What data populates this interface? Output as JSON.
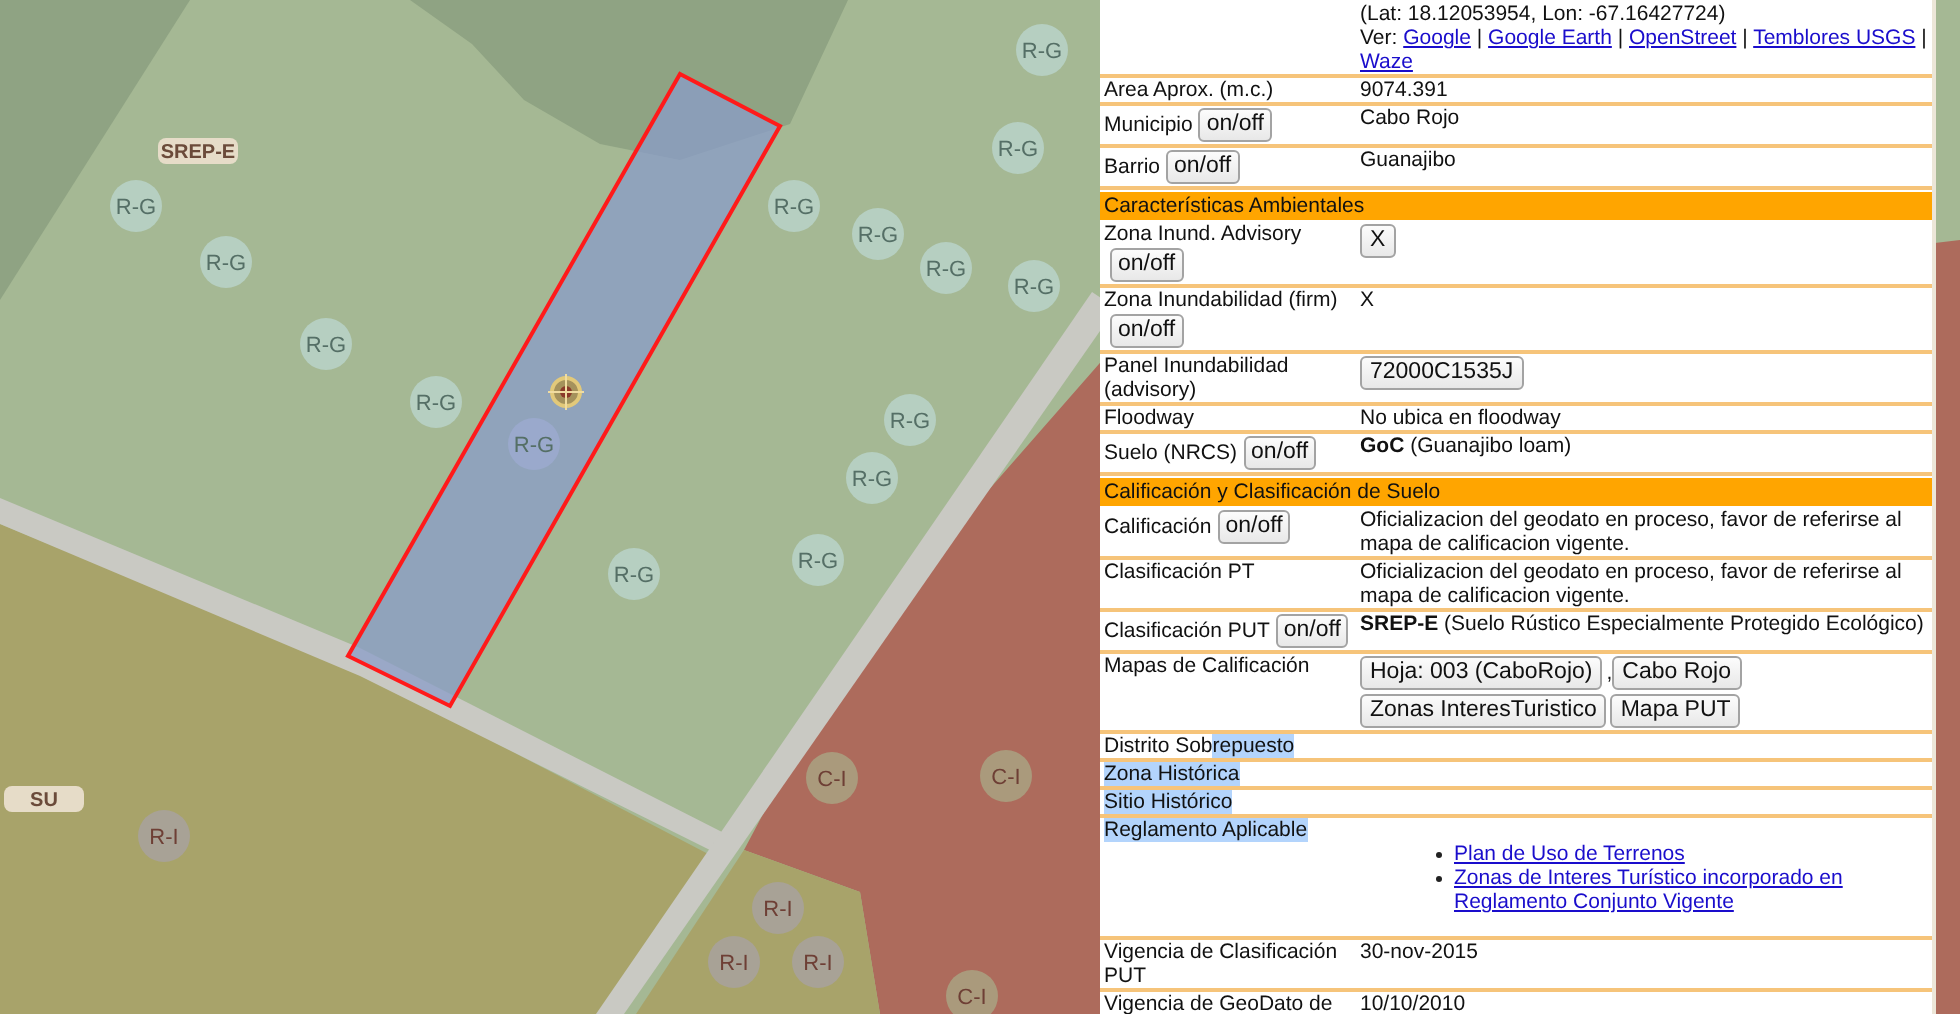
{
  "map": {
    "zone_labels": [
      {
        "text": "SREP-E"
      },
      {
        "text": "SU"
      }
    ],
    "zone_badges": [
      {
        "text": "R-G",
        "color": "#b6cfc1"
      },
      {
        "text": "R-G",
        "color": "#b6cfc1"
      },
      {
        "text": "R-G",
        "color": "#b6cfc1"
      },
      {
        "text": "R-G",
        "color": "#b6cfc1"
      },
      {
        "text": "R-G",
        "color": "#b6cfc1"
      },
      {
        "text": "R-G",
        "color": "#b6cfc1"
      },
      {
        "text": "R-G",
        "color": "#b6cfc1"
      },
      {
        "text": "R-G",
        "color": "#b6cfc1"
      },
      {
        "text": "R-G",
        "color": "#b6cfc1"
      },
      {
        "text": "R-G",
        "color": "#b6cfc1"
      },
      {
        "text": "R-G",
        "color": "#9aa9cc"
      },
      {
        "text": "R-G",
        "color": "#b6cfc1"
      },
      {
        "text": "R-G",
        "color": "#b6cfc1"
      },
      {
        "text": "R-G",
        "color": "#b6cfc1"
      },
      {
        "text": "R-G",
        "color": "#b6cfc1"
      },
      {
        "text": "R-I",
        "color": "#a8a296"
      },
      {
        "text": "R-I",
        "color": "#a8a296"
      },
      {
        "text": "R-I",
        "color": "#a8a296"
      },
      {
        "text": "R-I",
        "color": "#a8a296"
      },
      {
        "text": "C-I",
        "color": "#aa9a7c"
      },
      {
        "text": "C-I",
        "color": "#aa9a7c"
      },
      {
        "text": "C-I",
        "color": "#aa9a7c"
      }
    ]
  },
  "details": {
    "location": {
      "coordinates": "(Lat: 18.12053954, Lon: -67.16427724)",
      "view_label": "Ver:",
      "links": [
        {
          "text": "Google",
          "separator": "|"
        },
        {
          "text": "Google Earth",
          "separator": "|"
        },
        {
          "text": "OpenStreet",
          "separator": "|"
        },
        {
          "text": "Temblores USGS",
          "separator": "|"
        },
        {
          "text": "Waze"
        }
      ]
    },
    "rows": [
      {
        "kind": "field",
        "label": "Area Aprox. (m.c.)",
        "value": "9074.391"
      },
      {
        "kind": "field",
        "label": "Municipio",
        "toggle": "on/off",
        "value": "Cabo Rojo"
      },
      {
        "kind": "field",
        "label": "Barrio",
        "toggle": "on/off",
        "value": "Guanajibo"
      },
      {
        "kind": "section",
        "title": "Características Ambientales"
      },
      {
        "kind": "field",
        "label": "Zona Inund. Advisory",
        "toggle": "on/off",
        "buttons": [
          {
            "label": "X"
          }
        ]
      },
      {
        "kind": "field",
        "label": "Zona Inundabilidad (firm)",
        "toggle": "on/off",
        "value": "X"
      },
      {
        "kind": "field",
        "label": "Panel Inundabilidad (advisory)",
        "buttons": [
          {
            "label": "72000C1535J"
          }
        ]
      },
      {
        "kind": "field",
        "label": "Floodway",
        "value": "No ubica en floodway"
      },
      {
        "kind": "field",
        "label": "Suelo (NRCS)",
        "toggle": "on/off",
        "value": "**GoC** (Guanajibo loam)"
      },
      {
        "kind": "section",
        "title": "Calificación y Clasificación de Suelo"
      },
      {
        "kind": "field",
        "label": "Calificación",
        "toggle": "on/off",
        "value": "Oficializacion del geodato en proceso, favor de referirse al mapa de calificacion vigente."
      },
      {
        "kind": "field",
        "label": "Clasificación PT",
        "value": "Oficializacion del geodato en proceso, favor de referirse al mapa de calificacion vigente."
      },
      {
        "kind": "field",
        "label": "Clasificación PUT",
        "toggle": "on/off",
        "value": "**SREP-E** (Suelo Rústico Especialmente Protegido Ecológico)"
      },
      {
        "kind": "field",
        "label": "Mapas de Calificación",
        "buttons": [
          {
            "label": "Hoja: 003 (CaboRojo)",
            "trailing": ","
          },
          {
            "label": "Cabo Rojo"
          },
          {
            "label": "Zonas InteresTuristico"
          },
          {
            "label": "Mapa PUT"
          }
        ]
      },
      {
        "kind": "field",
        "label": "Distrito Sob",
        "label_highlighted": "repuesto"
      },
      {
        "kind": "field",
        "label_highlighted": "Zona Histórica"
      },
      {
        "kind": "field",
        "label_highlighted": "Sitio Histórico"
      },
      {
        "kind": "links",
        "label_highlighted": "Reglamento Aplicable",
        "links": [
          "Plan de Uso de Terrenos",
          "Zonas de Interes Turístico incorporado en Reglamento Conjunto Vigente"
        ]
      },
      {
        "kind": "field",
        "label": "Vigencia de Clasificación PUT",
        "value": "30-nov-2015"
      },
      {
        "kind": "field",
        "label": "Vigencia de GeoDato de",
        "value": "10/10/2010"
      }
    ]
  }
}
